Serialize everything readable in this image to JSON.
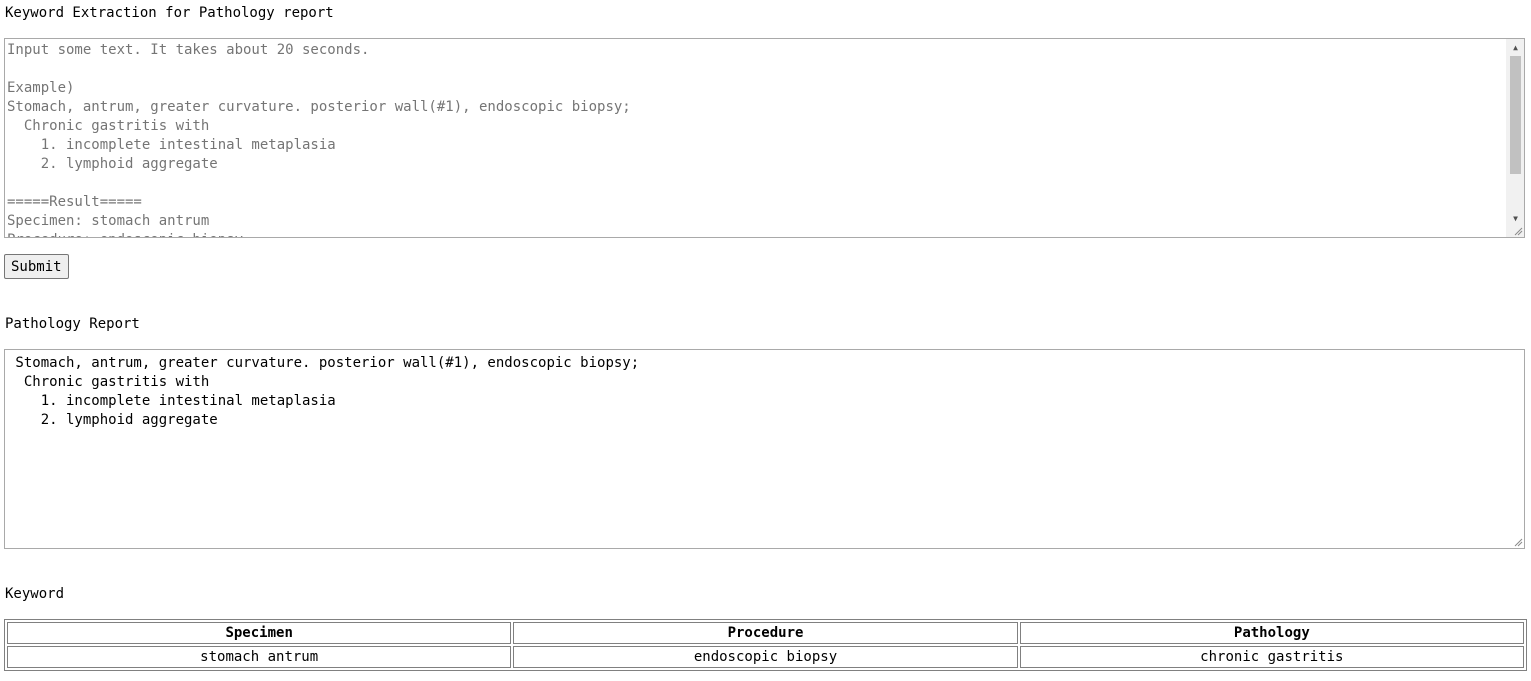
{
  "app_title": "Keyword Extraction for Pathology report",
  "input": {
    "placeholder": "Input some text. It takes about 20 seconds.\n\nExample)\nStomach, antrum, greater curvature. posterior wall(#1), endoscopic biopsy;\n  Chronic gastritis with\n    1. incomplete intestinal metaplasia\n    2. lymphoid aggregate\n\n=====Result=====\nSpecimen: stomach antrum\nProcedure: endoscopic biopsy"
  },
  "submit_label": "Submit",
  "report": {
    "heading": "Pathology Report",
    "value": " Stomach, antrum, greater curvature. posterior wall(#1), endoscopic biopsy;\n  Chronic gastritis with\n    1. incomplete intestinal metaplasia\n    2. lymphoid aggregate"
  },
  "keyword": {
    "heading": "Keyword",
    "columns": [
      "Specimen",
      "Procedure",
      "Pathology"
    ],
    "row": [
      "stomach antrum",
      "endoscopic biopsy",
      "chronic gastritis"
    ]
  }
}
